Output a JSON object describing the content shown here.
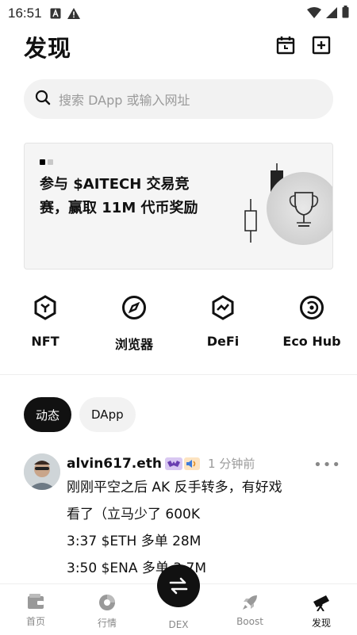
{
  "status": {
    "time": "16:51"
  },
  "header": {
    "title": "发现"
  },
  "search": {
    "placeholder": "搜索 DApp 或输入网址"
  },
  "banner": {
    "text": "参与 $AITECH 交易竞赛，赢取 11M 代币奖励"
  },
  "quick_actions": [
    {
      "label": "NFT",
      "icon": "nft-icon"
    },
    {
      "label": "浏览器",
      "icon": "compass-icon"
    },
    {
      "label": "DeFi",
      "icon": "defi-icon"
    },
    {
      "label": "Eco Hub",
      "icon": "eco-hub-icon"
    }
  ],
  "tabs": [
    {
      "label": "动态",
      "active": true
    },
    {
      "label": "DApp",
      "active": false
    }
  ],
  "post": {
    "username": "alvin617.eth",
    "time": "1 分钟前",
    "more": "•••",
    "lines": [
      "刚刚平空之后 AK 反手转多，有好戏",
      "看了（立马少了 600K",
      "3:37 $ETH 多单 28M",
      "3:50 $ENA 多单 3.7M"
    ]
  },
  "bottom_nav": [
    {
      "label": "首页",
      "icon": "wallet-icon"
    },
    {
      "label": "行情",
      "icon": "market-icon"
    },
    {
      "label": "DEX",
      "icon": "swap-icon"
    },
    {
      "label": "Boost",
      "icon": "rocket-icon"
    },
    {
      "label": "发现",
      "icon": "telescope-icon",
      "active": true
    }
  ],
  "colors": {
    "primary": "#111111",
    "muted": "#9a9a9a",
    "surface": "#f2f2f2"
  }
}
